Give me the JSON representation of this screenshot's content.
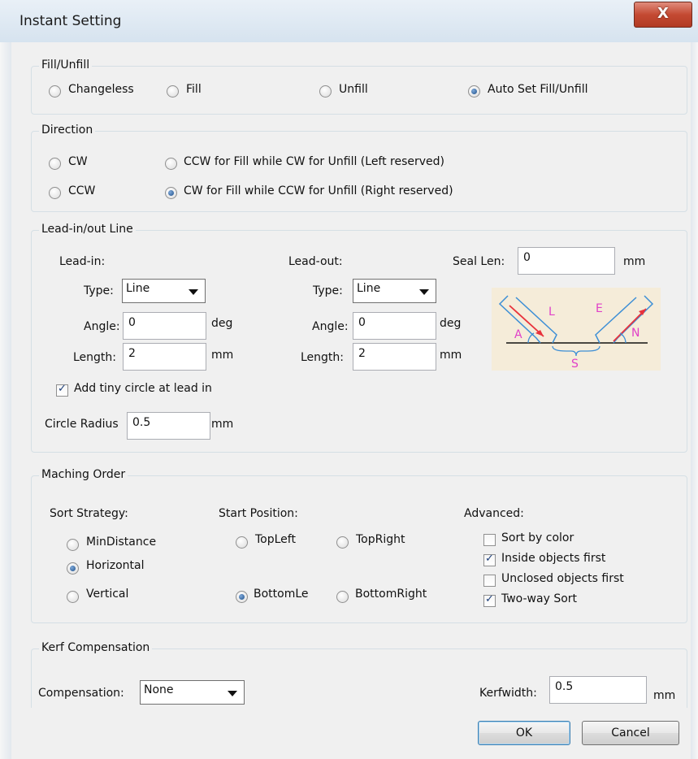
{
  "window": {
    "title": "Instant Setting",
    "close_glyph": "X"
  },
  "fill_unfill": {
    "legend": "Fill/Unfill",
    "options": [
      {
        "label": "Changeless",
        "selected": false
      },
      {
        "label": "Fill",
        "selected": false
      },
      {
        "label": "Unfill",
        "selected": false
      },
      {
        "label": "Auto Set Fill/Unfill",
        "selected": true
      }
    ]
  },
  "direction": {
    "legend": "Direction",
    "options": [
      {
        "label": "CW",
        "selected": false
      },
      {
        "label": "CCW for Fill while CW for Unfill (Left reserved)",
        "selected": false
      },
      {
        "label": "CCW",
        "selected": false
      },
      {
        "label": "CW for Fill while CCW for Unfill (Right reserved)",
        "selected": true
      }
    ]
  },
  "lead": {
    "legend": "Lead-in/out Line",
    "lead_in": {
      "title": "Lead-in:",
      "type_label": "Type:",
      "type_value": "Line",
      "angle_label": "Angle:",
      "angle_value": "0",
      "angle_unit": "deg",
      "length_label": "Length:",
      "length_value": "2",
      "length_unit": "mm"
    },
    "lead_out": {
      "title": "Lead-out:",
      "type_label": "Type:",
      "type_value": "Line",
      "angle_label": "Angle:",
      "angle_value": "0",
      "angle_unit": "deg",
      "length_label": "Length:",
      "length_value": "2",
      "length_unit": "mm"
    },
    "seal_len_label": "Seal Len:",
    "seal_len_value": "0",
    "seal_len_unit": "mm",
    "tiny_circle_label": "Add tiny circle at lead in",
    "tiny_circle_checked": true,
    "circle_radius_label": "Circle Radius",
    "circle_radius_value": "0.5",
    "circle_radius_unit": "mm",
    "diagram_letters": {
      "L": "L",
      "E": "E",
      "A": "A",
      "N": "N",
      "S": "S"
    }
  },
  "machining": {
    "legend": "Maching Order",
    "sort_strategy": {
      "label": "Sort Strategy:",
      "options": [
        {
          "label": "MinDistance",
          "selected": false
        },
        {
          "label": "Horizontal",
          "selected": true
        },
        {
          "label": "Vertical",
          "selected": false
        }
      ]
    },
    "start_position": {
      "label": "Start Position:",
      "options": [
        {
          "label": "TopLeft",
          "selected": false
        },
        {
          "label": "TopRight",
          "selected": false
        },
        {
          "label": "BottomLe",
          "selected": true
        },
        {
          "label": "BottomRight",
          "selected": false
        }
      ]
    },
    "advanced": {
      "label": "Advanced:",
      "options": [
        {
          "label": "Sort by color",
          "checked": false
        },
        {
          "label": "Inside objects first",
          "checked": true
        },
        {
          "label": "Unclosed objects first",
          "checked": false
        },
        {
          "label": "Two-way Sort",
          "checked": true
        }
      ]
    }
  },
  "kerf": {
    "legend": "Kerf Compensation",
    "compensation_label": "Compensation:",
    "compensation_value": "None",
    "kerfwidth_label": "Kerfwidth:",
    "kerfwidth_value": "0.5",
    "kerfwidth_unit": "mm"
  },
  "buttons": {
    "ok": "OK",
    "cancel": "Cancel"
  },
  "colors": {
    "titlebar": "#dfe9f3",
    "dialog_bg": "#f0f0f0",
    "close_red": "#c44a33",
    "diagram_bg": "#f5ecd9",
    "diagram_red": "#e8323c",
    "diagram_blue": "#3d8fd6",
    "diagram_pink": "#e040c8"
  }
}
